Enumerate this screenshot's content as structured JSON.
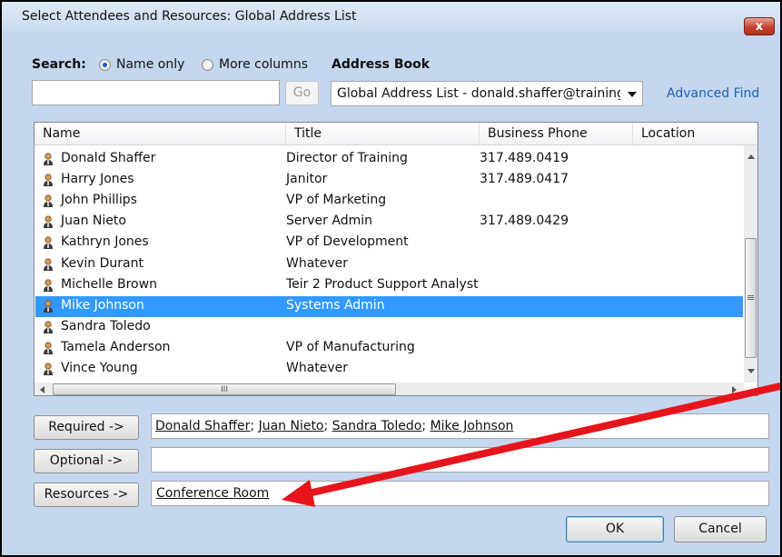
{
  "window": {
    "title": "Select Attendees and Resources: Global Address List",
    "close_label": "x"
  },
  "search": {
    "label": "Search:",
    "option_name_only": "Name only",
    "option_more_columns": "More columns",
    "selected_option": "Name only",
    "value": "",
    "go_label": "Go"
  },
  "address_book": {
    "label": "Address Book",
    "selected": "Global Address List - donald.shaffer@training",
    "advanced_find": "Advanced Find"
  },
  "list": {
    "columns": [
      "Name",
      "Title",
      "Business Phone",
      "Location"
    ],
    "rows": [
      {
        "name": "Donald Shaffer",
        "title": "Director of Training",
        "phone": "317.489.0419",
        "location": ""
      },
      {
        "name": "Harry Jones",
        "title": "Janitor",
        "phone": "317.489.0417",
        "location": ""
      },
      {
        "name": "John Phillips",
        "title": "VP of Marketing",
        "phone": "",
        "location": ""
      },
      {
        "name": "Juan Nieto",
        "title": "Server Admin",
        "phone": "317.489.0429",
        "location": ""
      },
      {
        "name": "Kathryn Jones",
        "title": "VP of Development",
        "phone": "",
        "location": ""
      },
      {
        "name": "Kevin Durant",
        "title": "Whatever",
        "phone": "",
        "location": ""
      },
      {
        "name": "Michelle Brown",
        "title": "Teir 2 Product Support Analyst",
        "phone": "",
        "location": ""
      },
      {
        "name": "Mike Johnson",
        "title": "Systems Admin",
        "phone": "",
        "location": ""
      },
      {
        "name": "Sandra Toledo",
        "title": "",
        "phone": "",
        "location": ""
      },
      {
        "name": "Tamela Anderson",
        "title": "VP of Manufacturing",
        "phone": "",
        "location": ""
      },
      {
        "name": "Vince Young",
        "title": "Whatever",
        "phone": "",
        "location": ""
      }
    ],
    "selected_row": "Mike Johnson",
    "hscroll_mark": "III",
    "vscroll_mark": "≡"
  },
  "recipients": {
    "required_label": "Required ->",
    "required": [
      "Donald Shaffer",
      "Juan Nieto",
      "Sandra Toledo",
      "Mike Johnson"
    ],
    "separator": ";",
    "optional_label": "Optional ->",
    "optional_value": "",
    "resources_label": "Resources ->",
    "resources": [
      "Conference Room"
    ]
  },
  "buttons": {
    "ok": "OK",
    "cancel": "Cancel"
  },
  "colors": {
    "selection": "#3399ff",
    "annotation_arrow": "#e8141b",
    "link": "#1e5fb4",
    "close_button": "#c4412e"
  },
  "icons": {
    "contact": "person-icon",
    "close": "close-icon",
    "dropdown": "chevron-down-icon"
  }
}
